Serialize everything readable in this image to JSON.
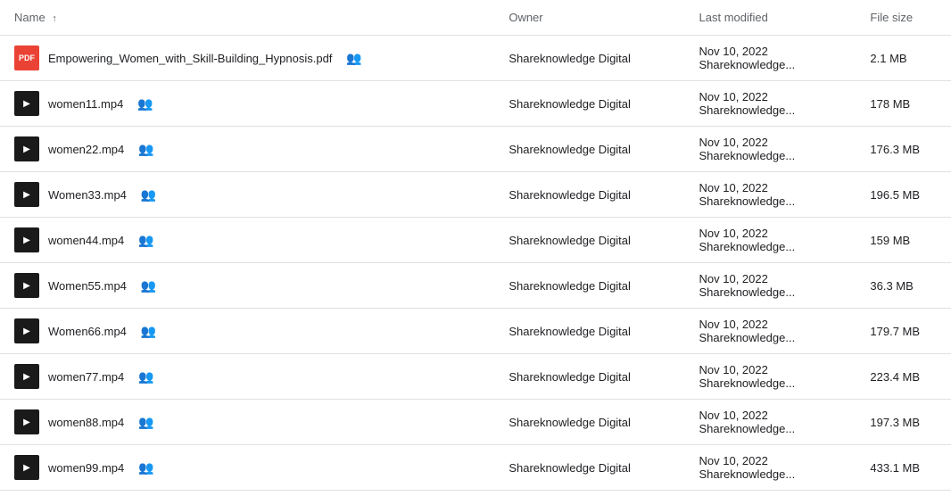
{
  "table": {
    "columns": {
      "name": "Name",
      "owner": "Owner",
      "modified": "Last modified",
      "size": "File size"
    },
    "rows": [
      {
        "id": 1,
        "type": "pdf",
        "name": "Empowering_Women_with_Skill-Building_Hypnosis.pdf",
        "shared": true,
        "owner": "Shareknowledge Digital",
        "modified": "Nov 10, 2022  Shareknowledge...",
        "size": "2.1 MB"
      },
      {
        "id": 2,
        "type": "video",
        "name": "women11.mp4",
        "shared": true,
        "owner": "Shareknowledge Digital",
        "modified": "Nov 10, 2022  Shareknowledge...",
        "size": "178 MB"
      },
      {
        "id": 3,
        "type": "video",
        "name": "women22.mp4",
        "shared": true,
        "owner": "Shareknowledge Digital",
        "modified": "Nov 10, 2022  Shareknowledge...",
        "size": "176.3 MB"
      },
      {
        "id": 4,
        "type": "video",
        "name": "Women33.mp4",
        "shared": true,
        "owner": "Shareknowledge Digital",
        "modified": "Nov 10, 2022  Shareknowledge...",
        "size": "196.5 MB"
      },
      {
        "id": 5,
        "type": "video",
        "name": "women44.mp4",
        "shared": true,
        "owner": "Shareknowledge Digital",
        "modified": "Nov 10, 2022  Shareknowledge...",
        "size": "159 MB"
      },
      {
        "id": 6,
        "type": "video",
        "name": "Women55.mp4",
        "shared": true,
        "owner": "Shareknowledge Digital",
        "modified": "Nov 10, 2022  Shareknowledge...",
        "size": "36.3 MB"
      },
      {
        "id": 7,
        "type": "video",
        "name": "Women66.mp4",
        "shared": true,
        "owner": "Shareknowledge Digital",
        "modified": "Nov 10, 2022  Shareknowledge...",
        "size": "179.7 MB"
      },
      {
        "id": 8,
        "type": "video",
        "name": "women77.mp4",
        "shared": true,
        "owner": "Shareknowledge Digital",
        "modified": "Nov 10, 2022  Shareknowledge...",
        "size": "223.4 MB"
      },
      {
        "id": 9,
        "type": "video",
        "name": "women88.mp4",
        "shared": true,
        "owner": "Shareknowledge Digital",
        "modified": "Nov 10, 2022  Shareknowledge...",
        "size": "197.3 MB"
      },
      {
        "id": 10,
        "type": "video",
        "name": "women99.mp4",
        "shared": true,
        "owner": "Shareknowledge Digital",
        "modified": "Nov 10, 2022  Shareknowledge...",
        "size": "433.1 MB"
      }
    ],
    "sort_icon": "↑",
    "pdf_label": "PDF",
    "shared_icon": "👥"
  }
}
